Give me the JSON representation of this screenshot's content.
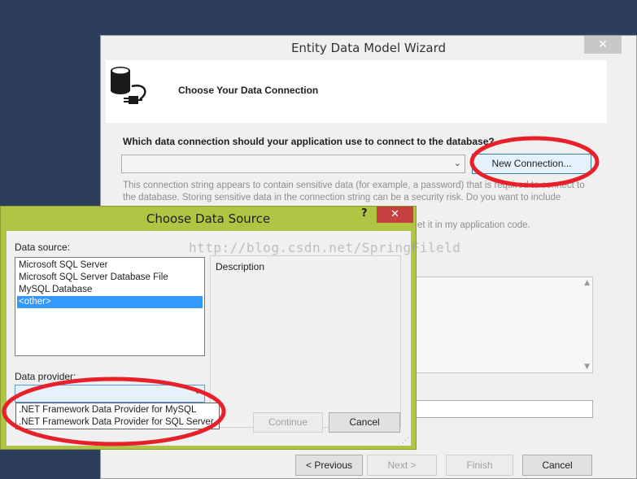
{
  "wizard": {
    "title": "Entity Data Model Wizard",
    "close_glyph": "✕",
    "header_title": "Choose Your Data Connection",
    "question": "Which data connection should your application use to connect to the database?",
    "selected_connection": "",
    "new_connection_label": "New Connection...",
    "sensitive_text": "This connection string appears to contain sensitive data (for example, a password) that is required to connect to the database. Storing sensitive data in the connection string can be a security risk. Do you want to include",
    "sensitive_tail": "et it in my application code.",
    "buttons": {
      "previous": "< Previous",
      "next": "Next >",
      "finish": "Finish",
      "cancel": "Cancel"
    }
  },
  "dialog": {
    "title": "Choose Data Source",
    "help_glyph": "?",
    "close_glyph": "✕",
    "data_source_label": "Data source:",
    "data_sources": [
      {
        "label": "Microsoft SQL Server",
        "selected": false
      },
      {
        "label": "Microsoft SQL Server Database File",
        "selected": false
      },
      {
        "label": "MySQL Database",
        "selected": false
      },
      {
        "label": "<other>",
        "selected": true
      }
    ],
    "description_label": "Description",
    "data_provider_label": "Data provider:",
    "selected_provider": "",
    "providers": [
      ".NET Framework Data Provider for MySQL",
      ".NET Framework Data Provider for SQL Server"
    ],
    "continue_label": "Continue",
    "cancel_label": "Cancel"
  },
  "watermark": "http://blog.csdn.net/SpringFileld",
  "colors": {
    "desktop": "#2c3e5c",
    "dialog_frame": "#b1c545",
    "dialog_close": "#c74040",
    "selection": "#3399ff",
    "annotation": "#e8202a"
  },
  "icons": {
    "database": "database-plug-icon"
  }
}
